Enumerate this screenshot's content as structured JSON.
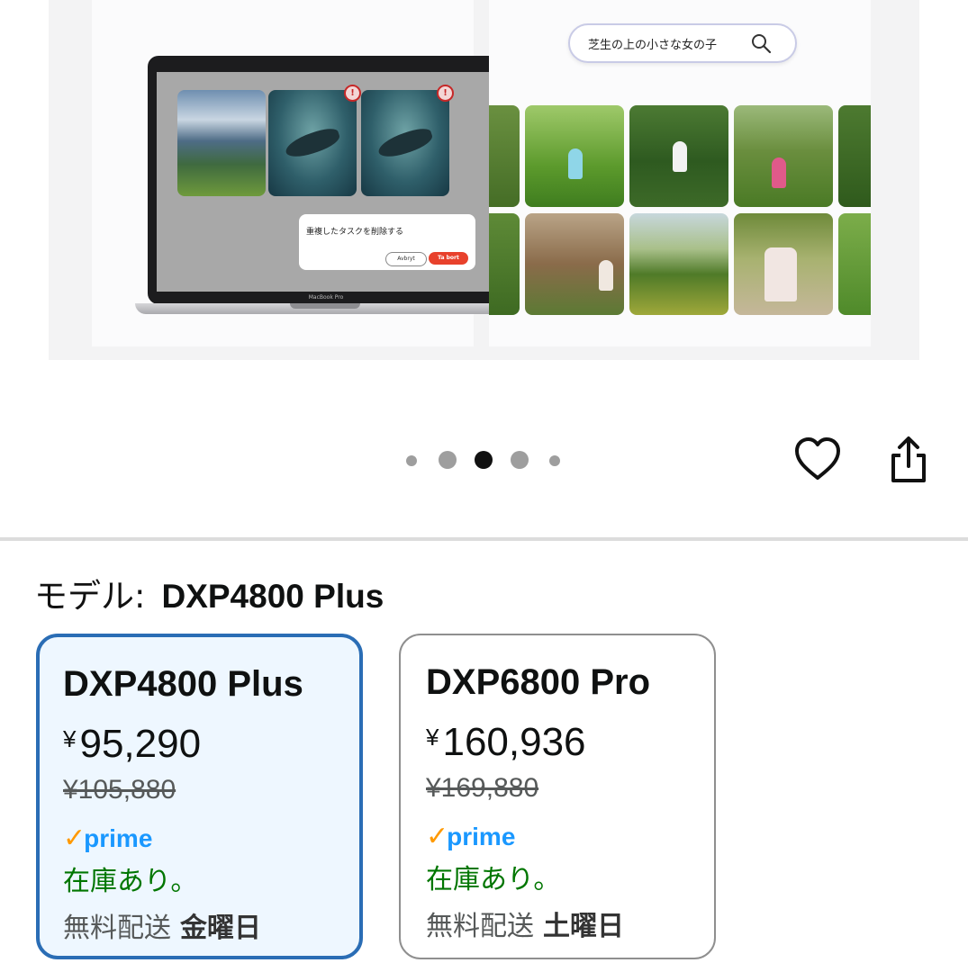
{
  "hero": {
    "dialog_title": "重複したタスクを削除する",
    "dialog_cancel": "Avbryt",
    "dialog_delete": "Ta bort",
    "laptop_brand": "MacBook Pro",
    "photo_search_text": "芝生の上の小さな女の子"
  },
  "carousel": {
    "total_dots": 5,
    "active_dot": 3
  },
  "actions": {
    "favorite_icon": "heart-outline",
    "share_icon": "share-upload"
  },
  "model": {
    "label": "モデル:",
    "selected": "DXP4800 Plus"
  },
  "options": [
    {
      "name": "DXP4800 Plus",
      "yen": "¥",
      "price": "95,290",
      "list_price": "¥105,880",
      "prime_label": "prime",
      "stock": "在庫あり。",
      "ship_label": "無料配送",
      "ship_day": "金曜日",
      "selected": true
    },
    {
      "name": "DXP6800 Pro",
      "yen": "¥",
      "price": "160,936",
      "list_price": "¥169,880",
      "prime_label": "prime",
      "stock": "在庫あり。",
      "ship_label": "無料配送",
      "ship_day": "土曜日",
      "selected": false
    }
  ],
  "colors": {
    "selected_border": "#2a6db5",
    "selected_bg": "#eef7ff",
    "stock_green": "#007600",
    "prime_blue": "#1a98ff",
    "prime_check": "#ff9900"
  }
}
